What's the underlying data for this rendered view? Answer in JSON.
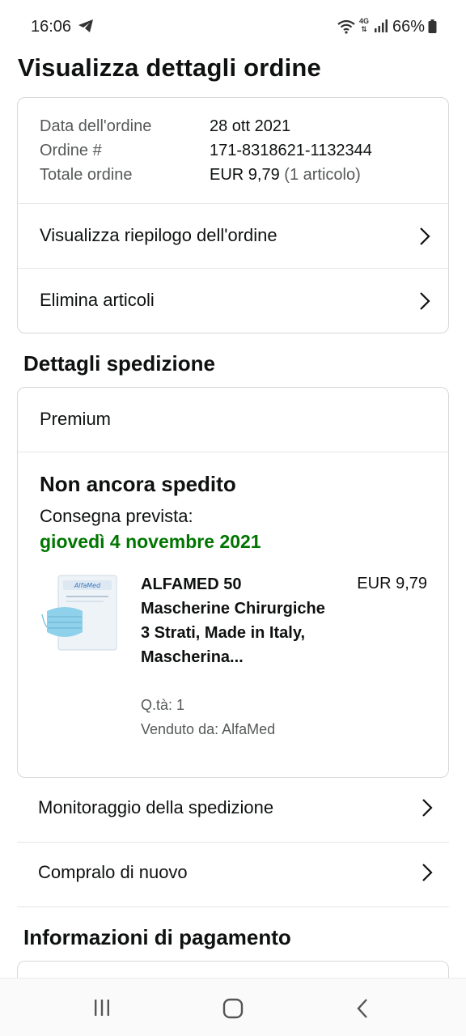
{
  "status_bar": {
    "time": "16:06",
    "network": "4G",
    "battery": "66%"
  },
  "page": {
    "title": "Visualizza dettagli ordine"
  },
  "order_summary": {
    "rows": [
      {
        "label": "Data dell'ordine",
        "value": "28 ott 2021",
        "extra": ""
      },
      {
        "label": "Ordine #",
        "value": "171-8318621-1132344",
        "extra": ""
      },
      {
        "label": "Totale ordine",
        "value": "EUR 9,79",
        "extra": "(1 articolo)"
      }
    ],
    "links": [
      {
        "label": "Visualizza riepilogo dell'ordine"
      },
      {
        "label": "Elimina articoli"
      }
    ]
  },
  "shipment": {
    "section_title": "Dettagli spedizione",
    "method": "Premium",
    "status": "Non ancora spedito",
    "expected_label": "Consegna prevista:",
    "expected_date": "giovedì 4 novembre 2021",
    "date_color": "#007600",
    "product": {
      "title": "ALFAMED 50 Mascherine Chirurgiche 3 Strati, Made in Italy, Mascherina...",
      "price": "EUR 9,79",
      "quantity": "Q.tà: 1",
      "seller": "Venduto da: AlfaMed",
      "image_brand": "AlfaMed"
    },
    "actions": [
      {
        "label": "Monitoraggio della spedizione"
      },
      {
        "label": "Compralo di nuovo"
      }
    ]
  },
  "payment": {
    "section_title": "Informazioni di pagamento"
  }
}
